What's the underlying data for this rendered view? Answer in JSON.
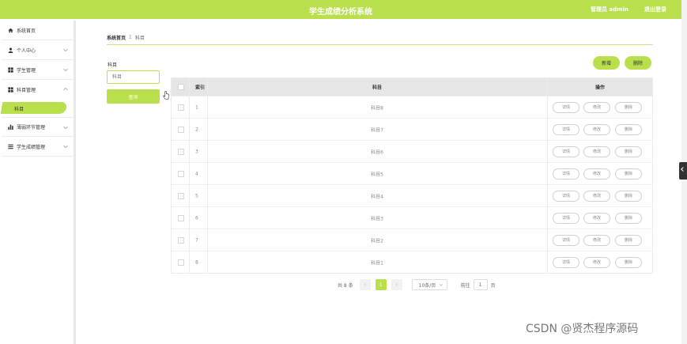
{
  "header": {
    "title": "学生成绩分析系统",
    "user": "管理员 admin",
    "logout": "退出登录"
  },
  "sidebar": {
    "items": [
      {
        "label": "系统首页",
        "icon": "home-icon"
      },
      {
        "label": "个人中心",
        "icon": "user-icon"
      },
      {
        "label": "学生管理",
        "icon": "grid-icon"
      },
      {
        "label": "科目管理",
        "icon": "grid-icon"
      },
      {
        "label": "薄弱环节管理",
        "icon": "bar-chart-icon"
      },
      {
        "label": "学生成绩管理",
        "icon": "list-icon"
      }
    ],
    "subitem": "科目"
  },
  "breadcrumb": {
    "home": "系统首页",
    "separator": "Σ",
    "current": "科目"
  },
  "search": {
    "label": "科目",
    "placeholder": "科目",
    "button": "查询"
  },
  "actions": {
    "add": "新增",
    "delete": "删除"
  },
  "table": {
    "headers": {
      "index": "索引",
      "name": "科目",
      "ops": "操作"
    },
    "op_labels": {
      "detail": "详情",
      "edit": "修改",
      "remove": "删除"
    },
    "rows": [
      {
        "index": "1",
        "name": "科目8"
      },
      {
        "index": "2",
        "name": "科目7"
      },
      {
        "index": "3",
        "name": "科目6"
      },
      {
        "index": "4",
        "name": "科目5"
      },
      {
        "index": "5",
        "name": "科目4"
      },
      {
        "index": "6",
        "name": "科目3"
      },
      {
        "index": "7",
        "name": "科目2"
      },
      {
        "index": "8",
        "name": "科目1"
      }
    ]
  },
  "pagination": {
    "total": "共 8 条",
    "current_page": "1",
    "page_size": "10条/页",
    "goto": "前往",
    "goto_value": "1",
    "page_unit": "页"
  },
  "watermark": "CSDN @贤杰程序源码",
  "colors": {
    "accent": "#b9df4c",
    "header_bg": "#b9df4c"
  }
}
